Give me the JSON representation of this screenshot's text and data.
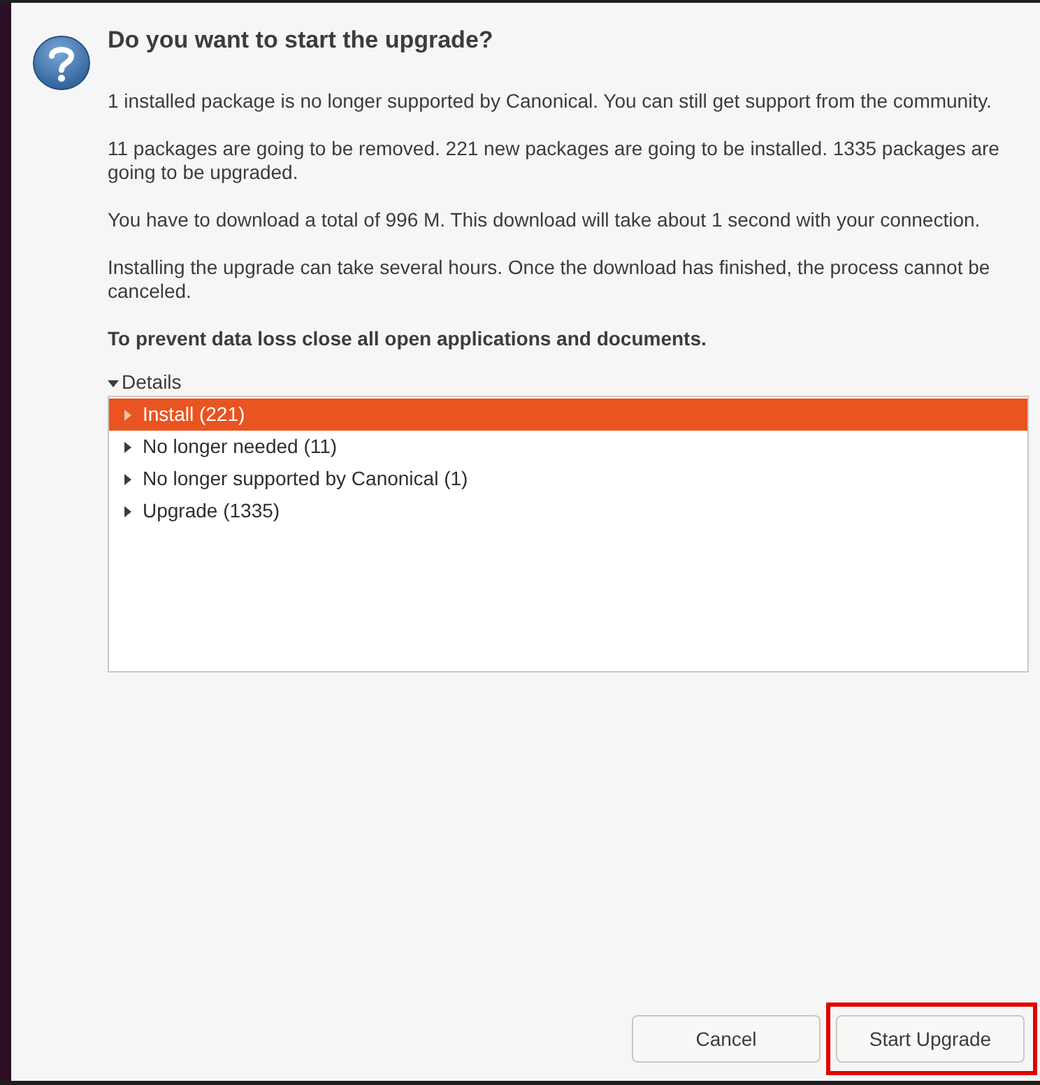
{
  "dialog": {
    "title": "Do you want to start the upgrade?",
    "paragraphs": [
      "1 installed package is no longer supported by Canonical. You can still get support from the community.",
      "11 packages are going to be removed. 221 new packages are going to be installed. 1335 packages are going to be upgraded.",
      "You have to download a total of 996 M. This download will take about 1 second with your connection.",
      "Installing the upgrade can take several hours. Once the download has finished, the process cannot be canceled."
    ],
    "warning": "To prevent data loss close all open applications and documents.",
    "details": {
      "label": "Details",
      "expanded": true,
      "rows": [
        {
          "label": "Install (221)",
          "selected": true,
          "expanded": false
        },
        {
          "label": "No longer needed (11)",
          "selected": false,
          "expanded": false
        },
        {
          "label": "No longer supported by Canonical (1)",
          "selected": false,
          "expanded": false
        },
        {
          "label": "Upgrade (1335)",
          "selected": false,
          "expanded": false
        }
      ]
    },
    "buttons": [
      {
        "label": "Cancel",
        "highlighted": false
      },
      {
        "label": "Start Upgrade",
        "highlighted": true
      }
    ]
  }
}
